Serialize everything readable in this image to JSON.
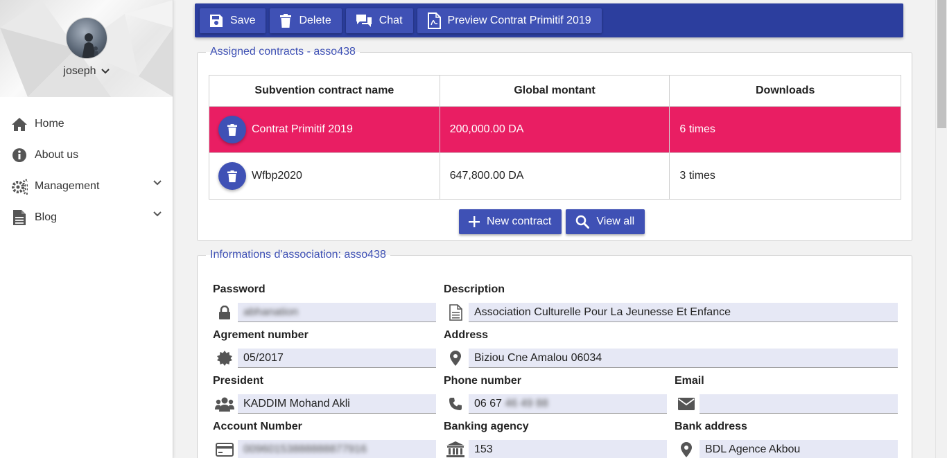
{
  "sidebar": {
    "username": "joseph",
    "items": [
      {
        "label": "Home",
        "icon": "home-icon"
      },
      {
        "label": "About us",
        "icon": "info-icon"
      },
      {
        "label": "Management",
        "icon": "gears-icon"
      },
      {
        "label": "Blog",
        "icon": "document-icon"
      }
    ]
  },
  "toolbar": {
    "save": "Save",
    "delete": "Delete",
    "chat": "Chat",
    "preview": "Preview Contrat Primitif 2019"
  },
  "contracts": {
    "legend": "Assigned contracts - asso438",
    "headers": [
      "Subvention contract name",
      "Global montant",
      "Downloads"
    ],
    "rows": [
      {
        "name": "Contrat Primitif 2019",
        "amount": "200,000.00 DA",
        "downloads": "6 times",
        "selected": true
      },
      {
        "name": "Wfbp2020",
        "amount": "647,800.00 DA",
        "downloads": "3 times",
        "selected": false
      }
    ],
    "new_contract": "New contract",
    "view_all": "View all"
  },
  "association": {
    "legend": "Informations d'association: asso438",
    "password": {
      "label": "Password",
      "value": "abhanation"
    },
    "description": {
      "label": "Description",
      "value": "Association Culturelle Pour La Jeunesse Et Enfance"
    },
    "agrement": {
      "label": "Agrement number",
      "value": "05/2017"
    },
    "address": {
      "label": "Address",
      "value": "Biziou Cne Amalou  06034"
    },
    "president": {
      "label": "President",
      "value": "KADDIM Mohand Akli"
    },
    "phone": {
      "label": "Phone number",
      "value": "06 67",
      "value_hidden": "46 49 88"
    },
    "email": {
      "label": "Email",
      "value": ""
    },
    "account": {
      "label": "Account Number",
      "value": "00960153888888877916"
    },
    "agency": {
      "label": "Banking agency",
      "value": "153"
    },
    "bank_address": {
      "label": "Bank address",
      "value": "BDL Agence Akbou"
    }
  },
  "colors": {
    "primary": "#3f51b5",
    "toolbar": "#2c3e9e",
    "selected_row": "#e91e63",
    "input_bg": "#e6e8f5"
  }
}
